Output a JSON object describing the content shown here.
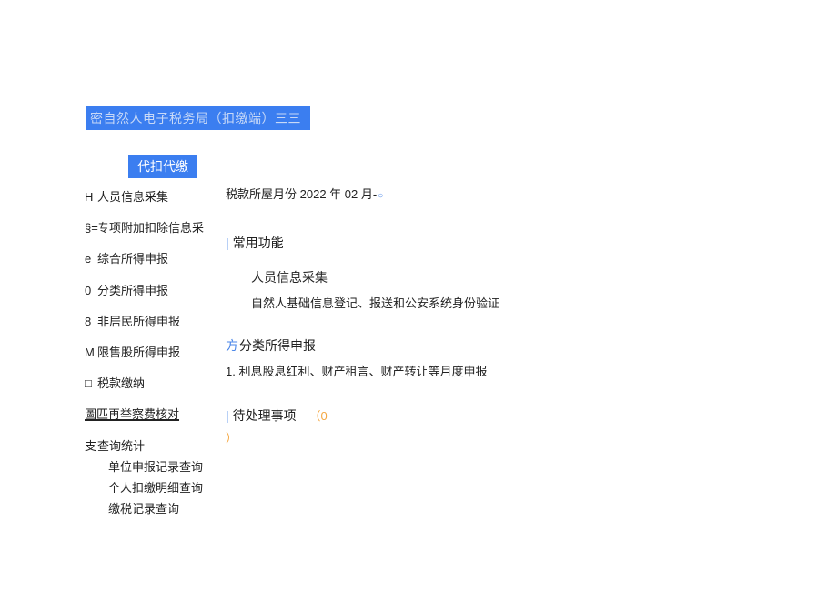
{
  "header": {
    "title": "密自然人电子税务局（扣缴端）三三"
  },
  "tab": {
    "active_label": "代扣代缴"
  },
  "sidebar": {
    "items": [
      {
        "prefix": "H",
        "label": "人员信息采集"
      },
      {
        "prefix": "§=",
        "label": "专项附加扣除信息采"
      },
      {
        "prefix": "e",
        "label": "综合所得申报"
      },
      {
        "prefix": "0",
        "label": "分类所得申报"
      },
      {
        "prefix": "8",
        "label": "非居民所得申报"
      },
      {
        "prefix": "M",
        "label": "限售股所得申报"
      },
      {
        "prefix": "□",
        "label": "税款缴纳"
      },
      {
        "prefix": "",
        "label": "圖匹再举察费核对",
        "underline": true
      },
      {
        "prefix": "支",
        "label": "查询统计"
      }
    ],
    "subitems": [
      {
        "label": "单位申报记录查询"
      },
      {
        "label": "个人扣缴明细查询"
      },
      {
        "label": "缴税记录查询"
      }
    ]
  },
  "period": {
    "label": "税款所屋月份",
    "value": "2022 年 02 月-"
  },
  "common_functions": {
    "title": "常用功能",
    "items": [
      {
        "title": "人员信息采集",
        "desc": "自然人基础信息登记、报送和公安系统身份验证"
      },
      {
        "prefix": "方",
        "title": "分类所得申报",
        "list_prefix": "1.",
        "desc": "利息股息红利、财产租言、财产转让等月度申报"
      }
    ]
  },
  "pending": {
    "title": "待处理事项",
    "count_open": "（0",
    "count_close": "）"
  }
}
